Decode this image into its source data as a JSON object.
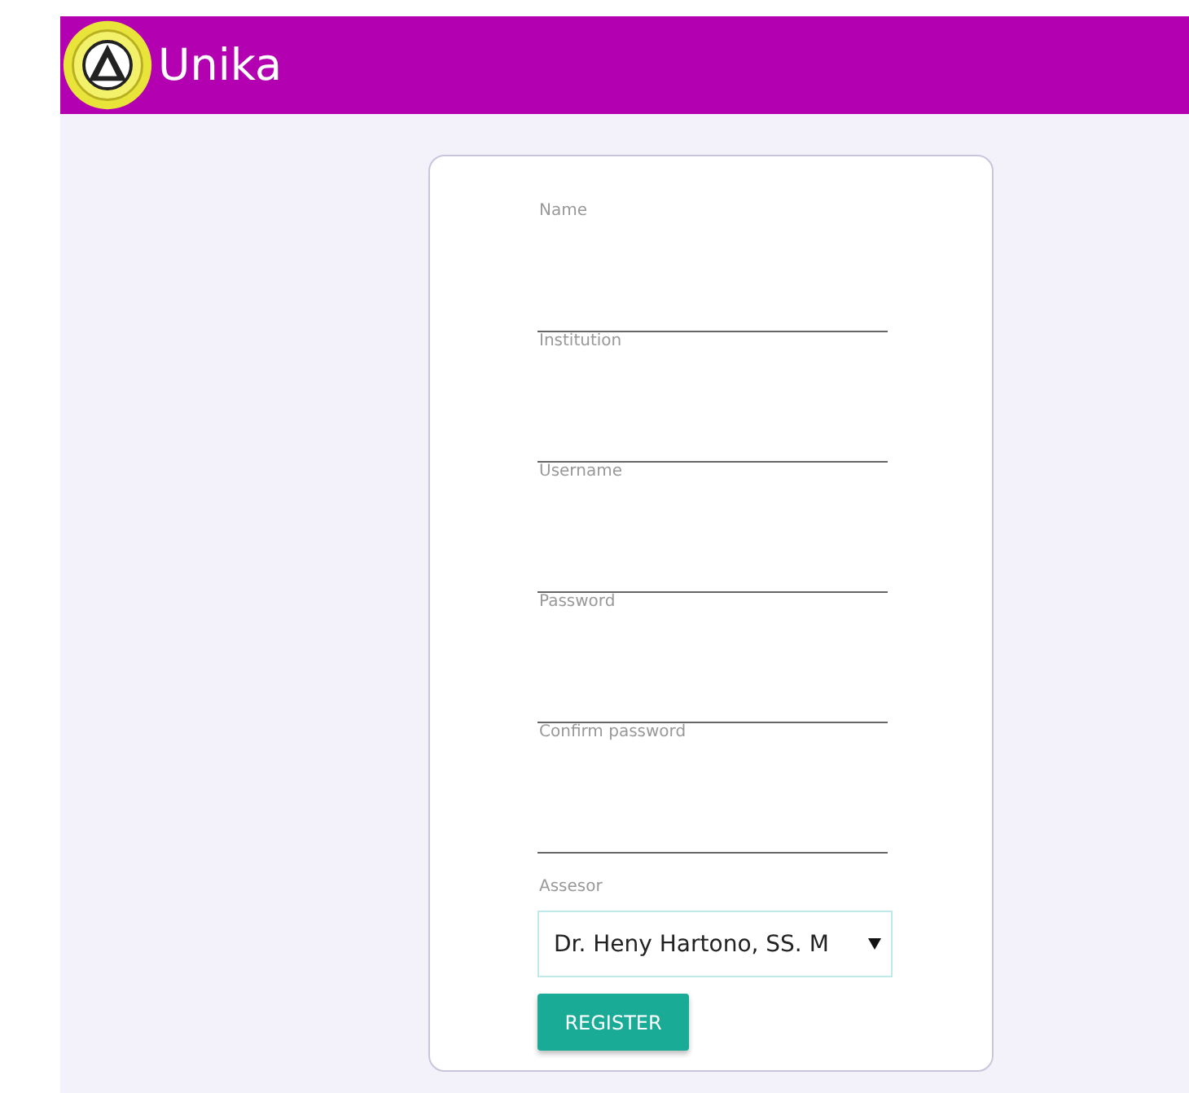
{
  "header": {
    "title": "Unika"
  },
  "form": {
    "fields": [
      {
        "label": "Name",
        "kind": "text"
      },
      {
        "label": "Institution",
        "kind": "text"
      },
      {
        "label": "Username",
        "kind": "text"
      },
      {
        "label": "Password",
        "kind": "password"
      },
      {
        "label": "Confirm password",
        "kind": "password"
      },
      {
        "label": "Assesor",
        "kind": "select",
        "value": "Dr. Heny Hartono, SS. M"
      }
    ],
    "button": "REGISTER"
  }
}
